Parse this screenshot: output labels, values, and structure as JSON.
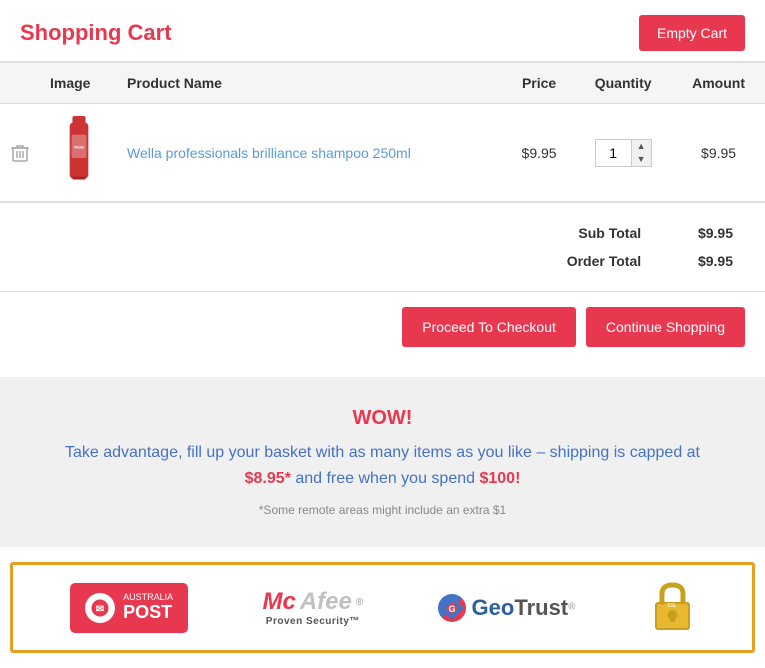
{
  "page": {
    "title": "Shopping Cart",
    "empty_cart_label": "Empty Cart"
  },
  "table": {
    "headers": {
      "image": "Image",
      "product_name": "Product Name",
      "price": "Price",
      "quantity": "Quantity",
      "amount": "Amount"
    },
    "rows": [
      {
        "product_name": "Wella professionals brilliance shampoo  250ml",
        "price": "$9.95",
        "quantity": 1,
        "amount": "$9.95"
      }
    ]
  },
  "totals": {
    "sub_total_label": "Sub Total",
    "sub_total_value": "$9.95",
    "order_total_label": "Order Total",
    "order_total_value": "$9.95"
  },
  "actions": {
    "checkout_label": "Proceed To Checkout",
    "continue_label": "Continue Shopping"
  },
  "promo": {
    "wow": "WOW!",
    "text_1": "Take advantage, fill up your basket with as many items as you like – shipping is capped at",
    "price_1": "$8.95*",
    "text_2": "and free when you spend",
    "price_2": "$100!",
    "disclaimer": "*Some remote areas might include an extra $1"
  },
  "badges": {
    "australia_post": {
      "small": "AUSTRALIA",
      "large": "POST"
    },
    "mcafee": {
      "name": "McAfee",
      "sub": "Proven Security™"
    },
    "geotrust": {
      "name": "GeoTrust"
    }
  },
  "icons": {
    "delete": "🗑",
    "up_arrow": "▲",
    "down_arrow": "▼",
    "lock": "🔒"
  }
}
